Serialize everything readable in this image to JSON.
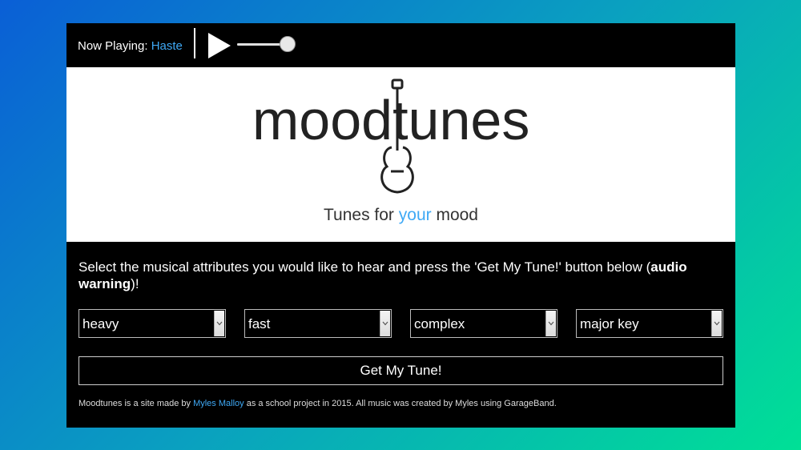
{
  "player": {
    "now_playing_label": "Now Playing:",
    "track_name": "Haste",
    "volume_fraction": 0.8
  },
  "header": {
    "logo_text": "moodtunes",
    "tagline_pre": "Tunes for ",
    "tagline_accent": "your",
    "tagline_post": " mood"
  },
  "main": {
    "instructions_text": "Select the musical attributes you would like to hear and press the 'Get My Tune!' button below (",
    "instructions_bold": "audio warning",
    "instructions_end": ")!",
    "selects": [
      {
        "value": "heavy"
      },
      {
        "value": "fast"
      },
      {
        "value": "complex"
      },
      {
        "value": "major key"
      }
    ],
    "button_label": "Get My Tune!"
  },
  "footer": {
    "pre": "Moodtunes is a site made by ",
    "author": "Myles Malloy",
    "post": " as a school project in 2015. All music was created by Myles using GarageBand."
  },
  "colors": {
    "accent": "#3fa9f5",
    "frame": "#000000"
  }
}
